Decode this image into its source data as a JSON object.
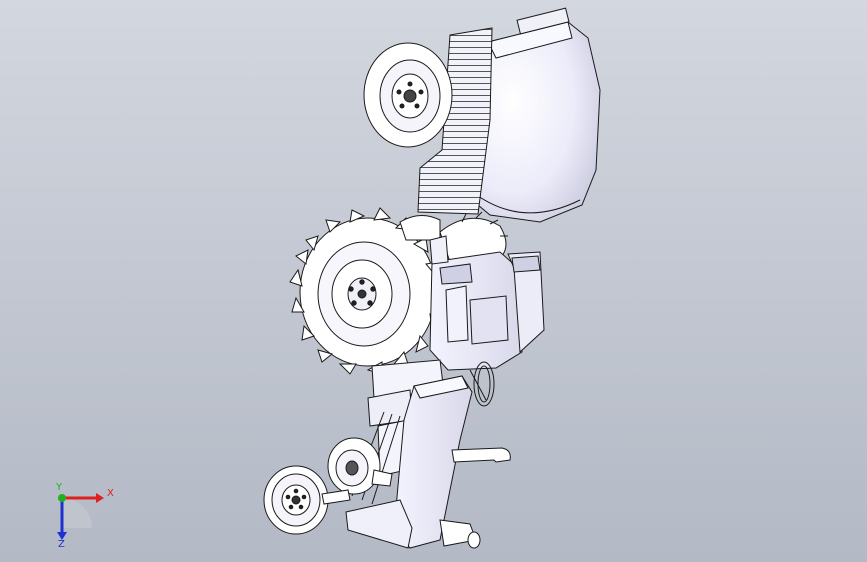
{
  "viewport": {
    "background_top": "#d3d7df",
    "background_bottom": "#b3b9c5"
  },
  "model": {
    "part_fill": "#ffffff",
    "tank_fill": "#ececfa",
    "body_fill": "#e6e6f6",
    "outline": "#1a1a1a"
  },
  "triad": {
    "x_label": "X",
    "y_label": "Y",
    "z_label": "Z",
    "x_color": "#e02020",
    "y_color": "#20b020",
    "z_color": "#2030d0"
  }
}
